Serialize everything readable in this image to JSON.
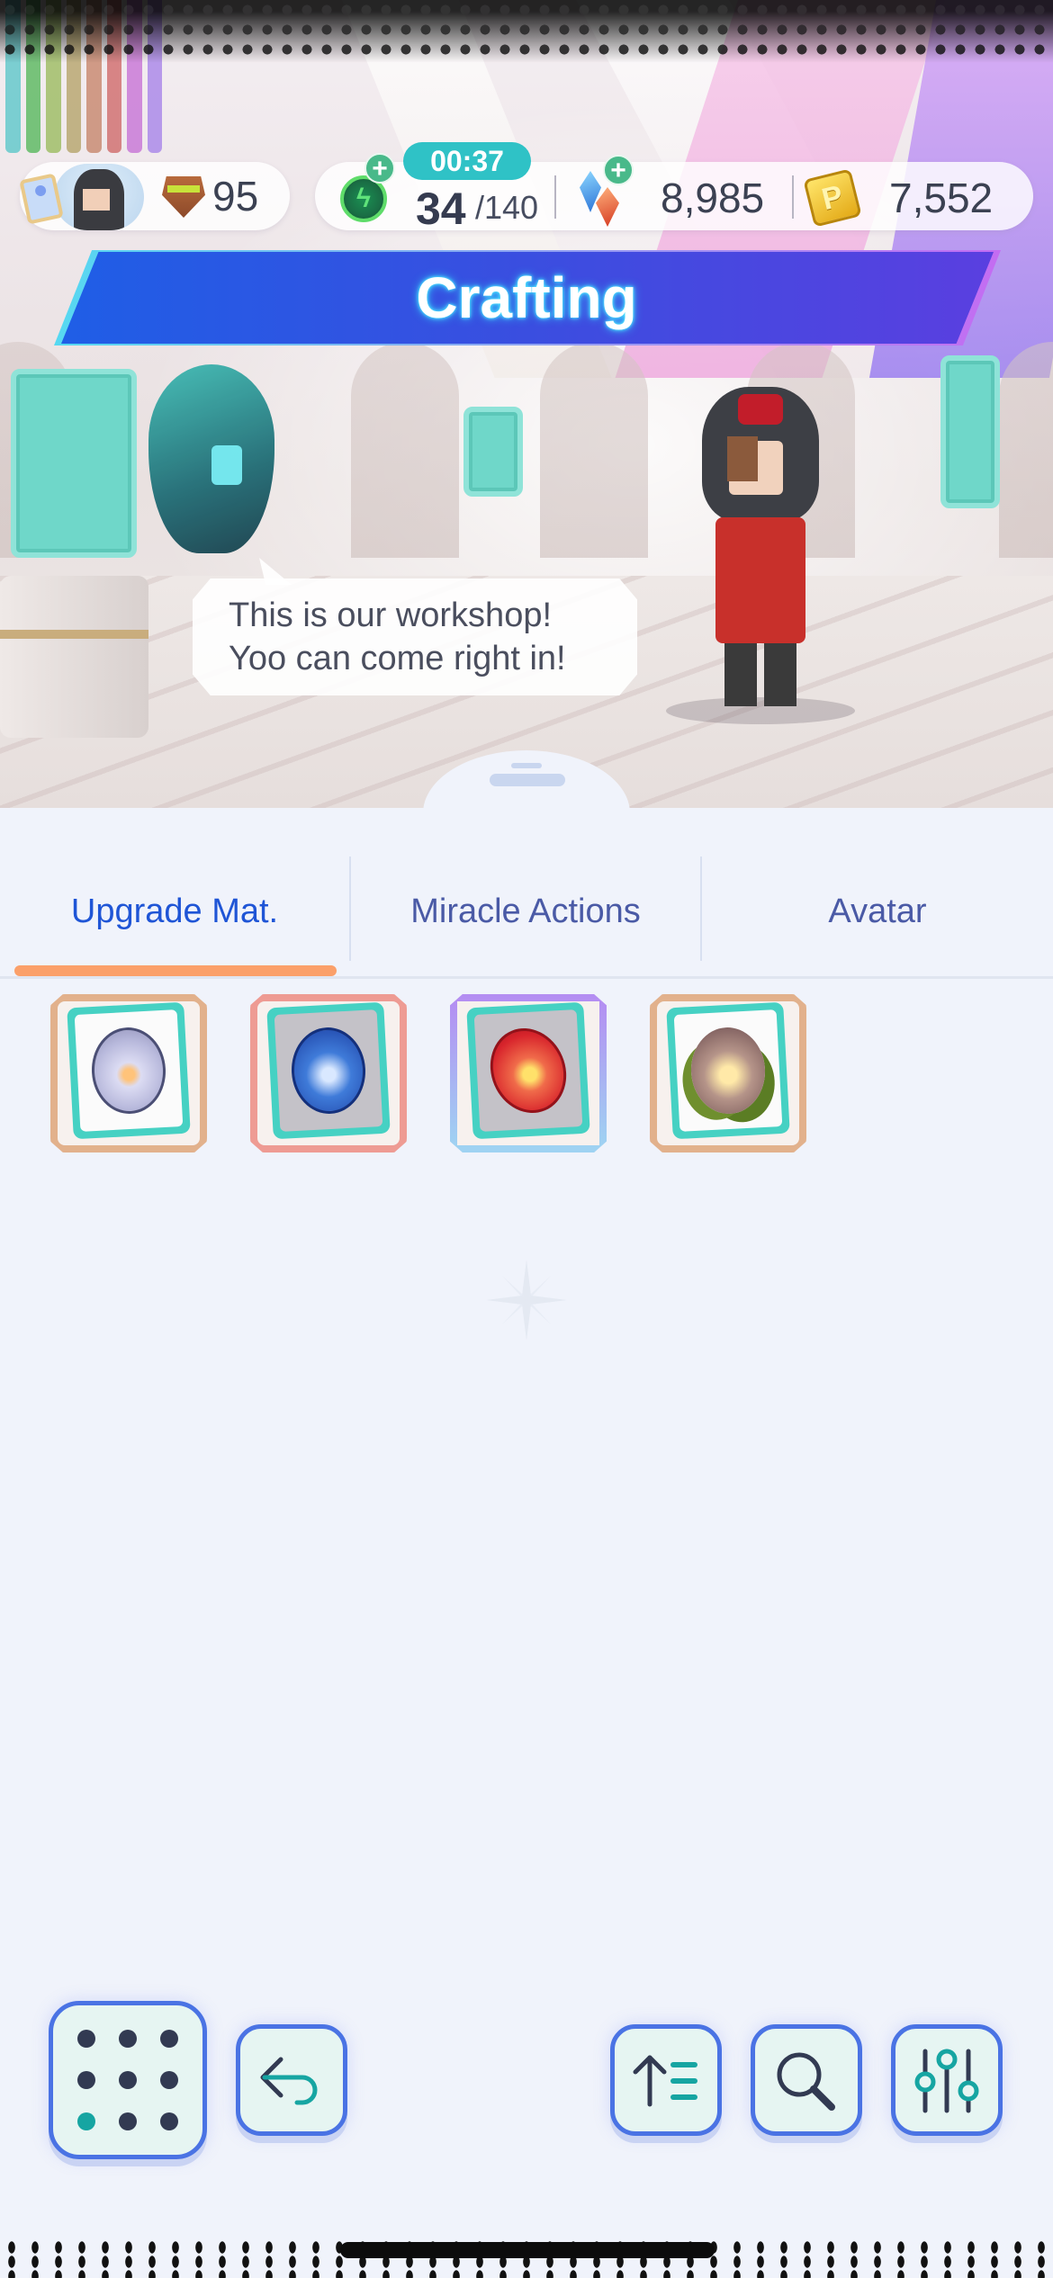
{
  "hud": {
    "rank_icon": "rank-badge-icon",
    "rank_value": "95",
    "stamina": {
      "icon": "lightning-stamina-icon",
      "timer": "00:37",
      "current": "34",
      "max": "/140",
      "add_icon": "plus-icon"
    },
    "gems": {
      "icon": "gem-crystals-icon",
      "value": "8,985",
      "add_icon": "plus-icon"
    },
    "coins": {
      "icon": "p-coin-icon",
      "glyph": "P",
      "value": "7,552"
    },
    "plus_glyph": "+"
  },
  "title": "Crafting",
  "dialog": {
    "line1": "This is our workshop!",
    "line2": "Yoo can come right in!"
  },
  "tabs": [
    {
      "label": "Upgrade Mat.",
      "active": true
    },
    {
      "label": "Miracle Actions",
      "active": false
    },
    {
      "label": "Avatar",
      "active": false
    }
  ],
  "items": [
    {
      "name": "silver-orb",
      "frame": "bronze",
      "icon": "silver-orb-icon"
    },
    {
      "name": "blue-orb",
      "frame": "red",
      "icon": "blue-orb-icon"
    },
    {
      "name": "red-orb",
      "frame": "purple",
      "icon": "red-orb-icon"
    },
    {
      "name": "seed-orb",
      "frame": "bronze",
      "icon": "seed-orb-icon"
    }
  ],
  "colors": {
    "tab_active": "#1f55d6",
    "tab_inactive": "#4a5aa6",
    "tab_underline": "#fba06a",
    "button_border": "#4a73e4",
    "button_fill": "#e6f5f2",
    "accent_teal": "#16a5a2",
    "banner_start": "#1f5ee6",
    "banner_end": "#5a3fe0"
  },
  "toolbar": {
    "menu": "grid-menu-icon",
    "back": "back-arrow-icon",
    "sort": "sort-ascending-icon",
    "search": "search-icon",
    "filter": "filter-sliders-icon"
  }
}
